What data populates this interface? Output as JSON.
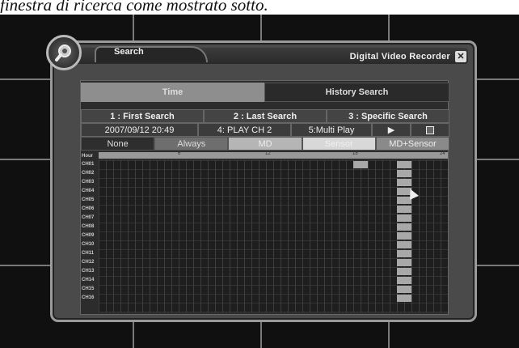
{
  "caption": "finestra di ricerca come mostrato sotto.",
  "window": {
    "tab_title": "Search",
    "app_title": "Digital Video Recorder",
    "close_symbol": "✕"
  },
  "tabs": [
    {
      "label": "Time",
      "active": true
    },
    {
      "label": "History Search",
      "active": false
    }
  ],
  "search_modes": {
    "first": "1 : First Search",
    "last": "2 : Last Search",
    "specific": "3 : Specific Search"
  },
  "playback": {
    "datetime": "2007/09/12 20:49",
    "play_channel": "4: PLAY CH 2",
    "multi_play": "5:Multi Play",
    "play_symbol": "▶",
    "save_icon": "save-icon"
  },
  "record_types": [
    {
      "label": "None",
      "color": "#2e2e2e",
      "text": "#ddd"
    },
    {
      "label": "Always",
      "color": "#6e6e6e",
      "text": "#ddd"
    },
    {
      "label": "MD",
      "color": "#b5b5b5",
      "text": "#eee"
    },
    {
      "label": "Sensor",
      "color": "#d8d8d8",
      "text": "#f0f0f0"
    },
    {
      "label": "MD+Sensor",
      "color": "#8a8a8a",
      "text": "#eee"
    }
  ],
  "timeline": {
    "corner_label": "Hour",
    "ticks": [
      {
        "label": "6",
        "hour": 6
      },
      {
        "label": "12",
        "hour": 12
      },
      {
        "label": "18",
        "hour": 18
      },
      {
        "label": "24",
        "hour": 24
      }
    ],
    "channels": [
      "CH01",
      "CH02",
      "CH03",
      "CH04",
      "CH05",
      "CH06",
      "CH07",
      "CH08",
      "CH09",
      "CH10",
      "CH11",
      "CH12",
      "CH13",
      "CH14",
      "CH15",
      "CH16"
    ],
    "recordings": [
      {
        "channel": "CH01",
        "start_hour": 17.5,
        "end_hour": 18.5
      },
      {
        "channel": "CH01",
        "start_hour": 20.5,
        "end_hour": 21.5
      },
      {
        "channel": "CH02",
        "start_hour": 20.5,
        "end_hour": 21.5
      },
      {
        "channel": "CH03",
        "start_hour": 20.5,
        "end_hour": 21.5
      },
      {
        "channel": "CH04",
        "start_hour": 20.5,
        "end_hour": 21.5
      },
      {
        "channel": "CH05",
        "start_hour": 20.5,
        "end_hour": 21.5
      },
      {
        "channel": "CH06",
        "start_hour": 20.5,
        "end_hour": 21.5
      },
      {
        "channel": "CH07",
        "start_hour": 20.5,
        "end_hour": 21.5
      },
      {
        "channel": "CH08",
        "start_hour": 20.5,
        "end_hour": 21.5
      },
      {
        "channel": "CH09",
        "start_hour": 20.5,
        "end_hour": 21.5
      },
      {
        "channel": "CH10",
        "start_hour": 20.5,
        "end_hour": 21.5
      },
      {
        "channel": "CH11",
        "start_hour": 20.5,
        "end_hour": 21.5
      },
      {
        "channel": "CH12",
        "start_hour": 20.5,
        "end_hour": 21.5
      },
      {
        "channel": "CH13",
        "start_hour": 20.5,
        "end_hour": 21.5
      },
      {
        "channel": "CH14",
        "start_hour": 20.5,
        "end_hour": 21.5
      },
      {
        "channel": "CH15",
        "start_hour": 20.5,
        "end_hour": 21.5
      },
      {
        "channel": "CH16",
        "start_hour": 20.5,
        "end_hour": 21.5
      }
    ],
    "cursor_hour": 21.2,
    "cursor_channel": "CH04"
  }
}
